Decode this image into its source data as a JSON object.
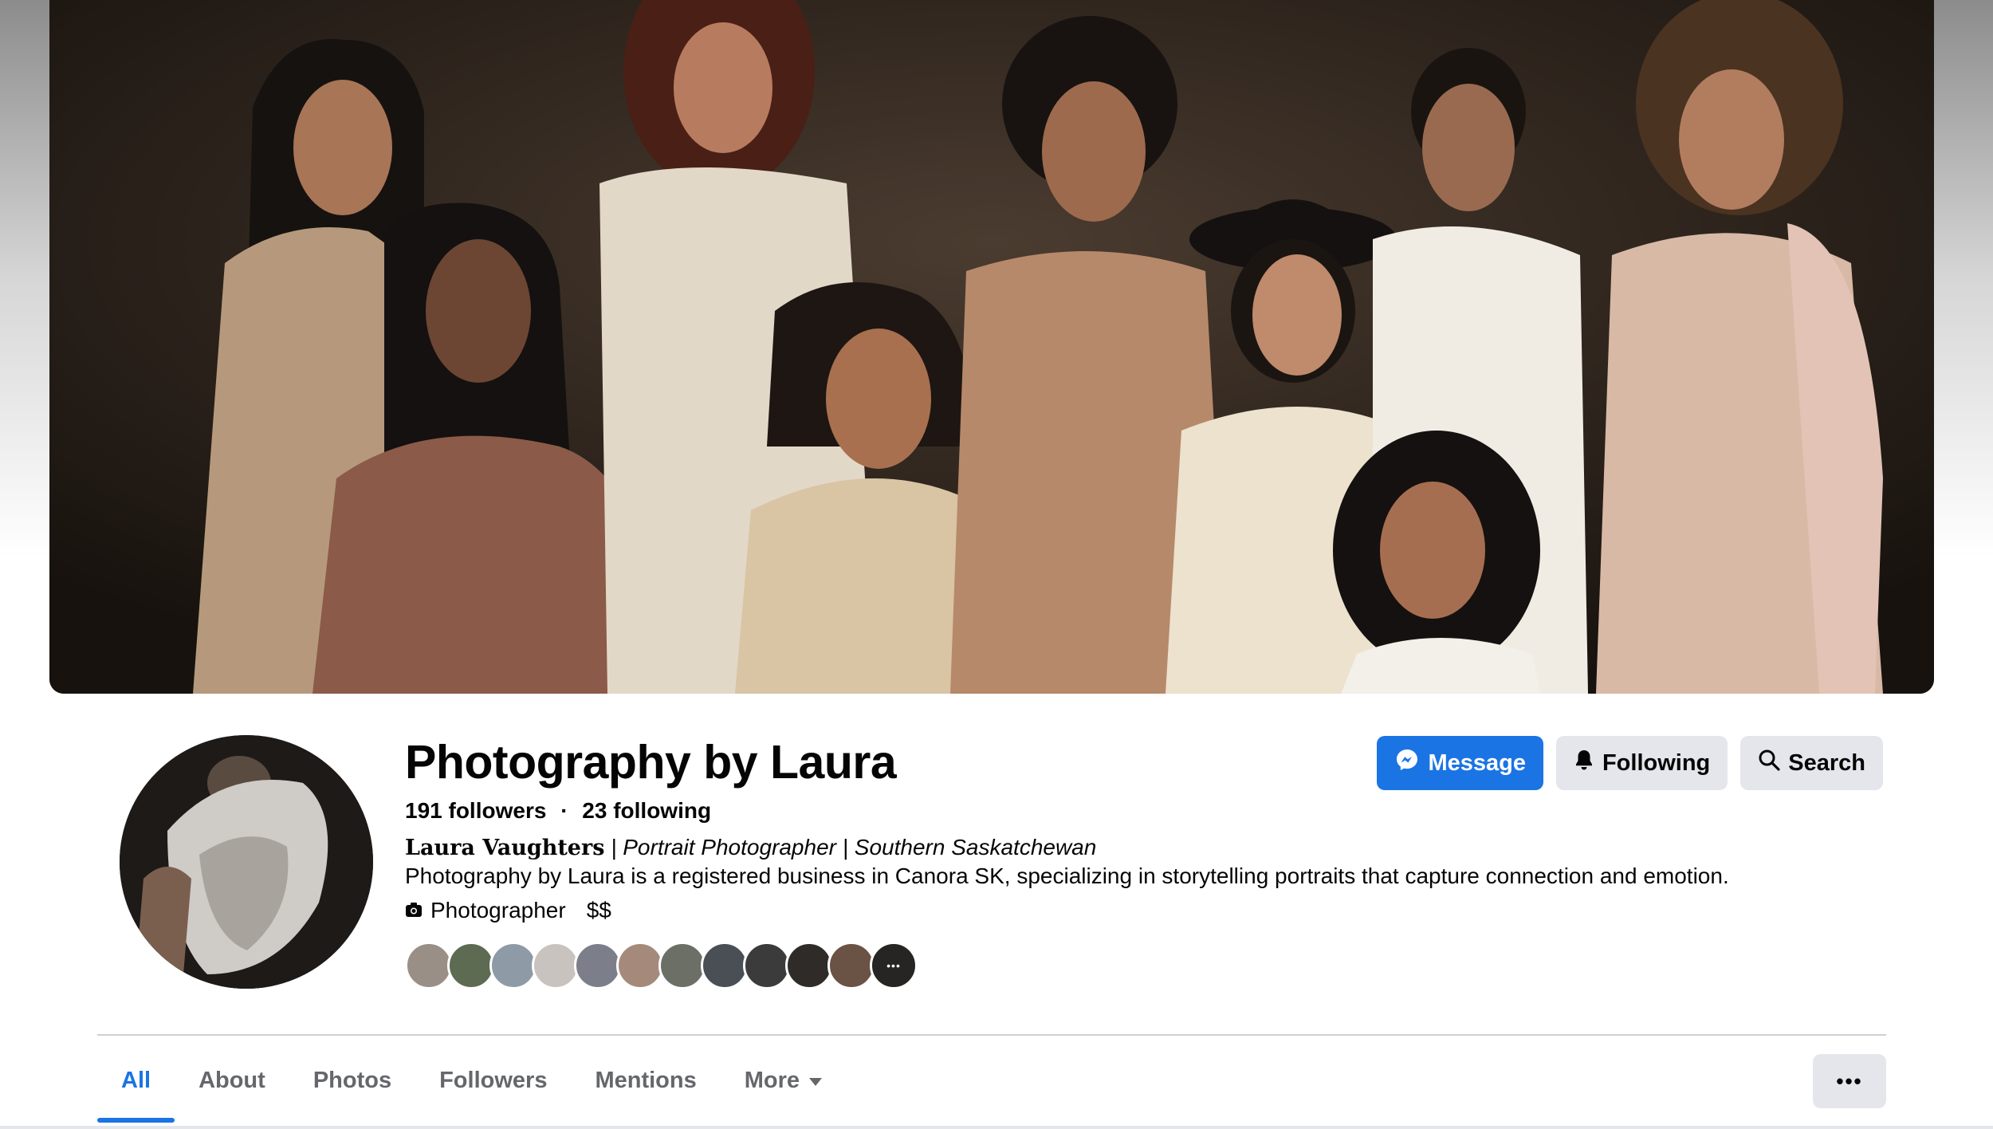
{
  "page": {
    "title": "Photography by Laura",
    "followers_text": "191 followers",
    "separator": "·",
    "following_text": "23 following",
    "bio_name": "Laura Vaughters",
    "bio_roles": " | Portrait Photographer | Southern Saskatchewan",
    "description": "Photography by Laura is a registered business in Canora SK, specializing in storytelling portraits that capture connection and emotion.",
    "category": "Photographer",
    "price_range": "$$",
    "friend_avatar_colors": [
      "#9a8f86",
      "#5c6b52",
      "#8e9aa5",
      "#c9c3c0",
      "#7c7e8a",
      "#a58a7c",
      "#6c6f65",
      "#4a4f56",
      "#3b3b3b",
      "#2e2b28",
      "#6a5244",
      "#3d3a36"
    ]
  },
  "actions": {
    "message": "Message",
    "following": "Following",
    "search": "Search"
  },
  "tabs": [
    {
      "label": "All",
      "active": true
    },
    {
      "label": "About"
    },
    {
      "label": "Photos"
    },
    {
      "label": "Followers"
    },
    {
      "label": "Mentions"
    },
    {
      "label": "More"
    }
  ],
  "more_menu": "•••",
  "colors": {
    "accent": "#1b74e4",
    "secondary_bg": "#e4e6eb",
    "text_secondary": "#65676b"
  },
  "icons": {
    "message": "messenger-icon",
    "following": "bell-icon",
    "search": "search-icon",
    "category": "camera-icon",
    "more": "caret-down-icon"
  }
}
